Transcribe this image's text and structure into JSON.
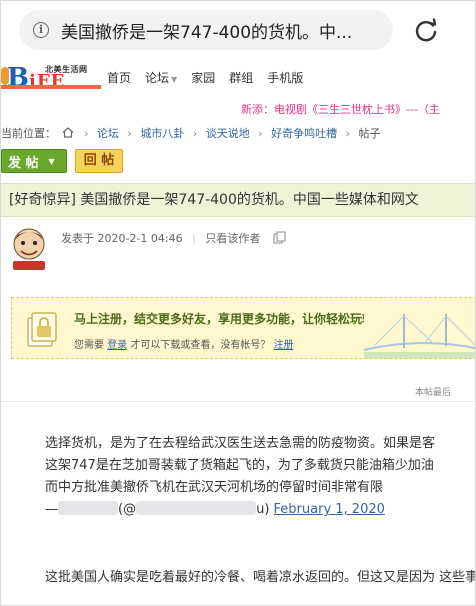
{
  "browser": {
    "address_text": "美国撤侨是一架747-400的货机。中...",
    "info_icon": "info-icon",
    "reload_icon": "reload-icon"
  },
  "site": {
    "logo_top": "北美生活网",
    "logo_b": "B",
    "logo_ife": "iFE",
    "nav": [
      {
        "label": "首页",
        "has_caret": false
      },
      {
        "label": "论坛",
        "has_caret": true
      },
      {
        "label": "家园",
        "has_caret": false
      },
      {
        "label": "群组",
        "has_caret": false
      },
      {
        "label": "手机版",
        "has_caret": false
      }
    ],
    "promo": "新添：电视剧《三生三世枕上书》---（主"
  },
  "breadcrumb": {
    "prefix": "当前位置：",
    "items": [
      "论坛",
      "城市八卦",
      "谈天说地",
      "好奇争鸣吐槽"
    ],
    "current": "帖子",
    "separator": "›"
  },
  "actions": {
    "post_label": "发 帖",
    "reply_label": "回 帖"
  },
  "thread": {
    "title": "[好奇惊异] 美国撤侨是一架747-400的货机。中国一些媒体和网文"
  },
  "post": {
    "meta_posted": "发表于 2020-2-1 04:46",
    "meta_only_author": "只看该作者",
    "register_main": "马上注册，结交更多好友，享用更多功能，让你轻松玩转社区。",
    "register_sub_1": "您需要",
    "register_login": "登录",
    "register_sub_2": "才可以下载或查看，没有帐号？",
    "register_signup": "注册",
    "last_edit_note": "本帖最后",
    "lines": [
      "选择货机，是为了在去程给武汉医生送去急需的防疫物资。如果是客",
      "这架747是在芝加哥装载了货箱起飞的，为了多载货只能油箱少加油",
      "而中方批准美撤侨飞机在武汉天河机场的停留时间非常有限"
    ],
    "sig_prefix": "—",
    "sig_at": "(@",
    "sig_suffix": "u)",
    "sig_date": "February 1, 2020",
    "lines2": [
      "这批美国人确实是吃着最好的冷餐、喝着凉水返回的。但这又是因为",
      "这些事，中国媒体没有正当报道也就算了。但利用货机撤侨这件事职"
    ]
  }
}
